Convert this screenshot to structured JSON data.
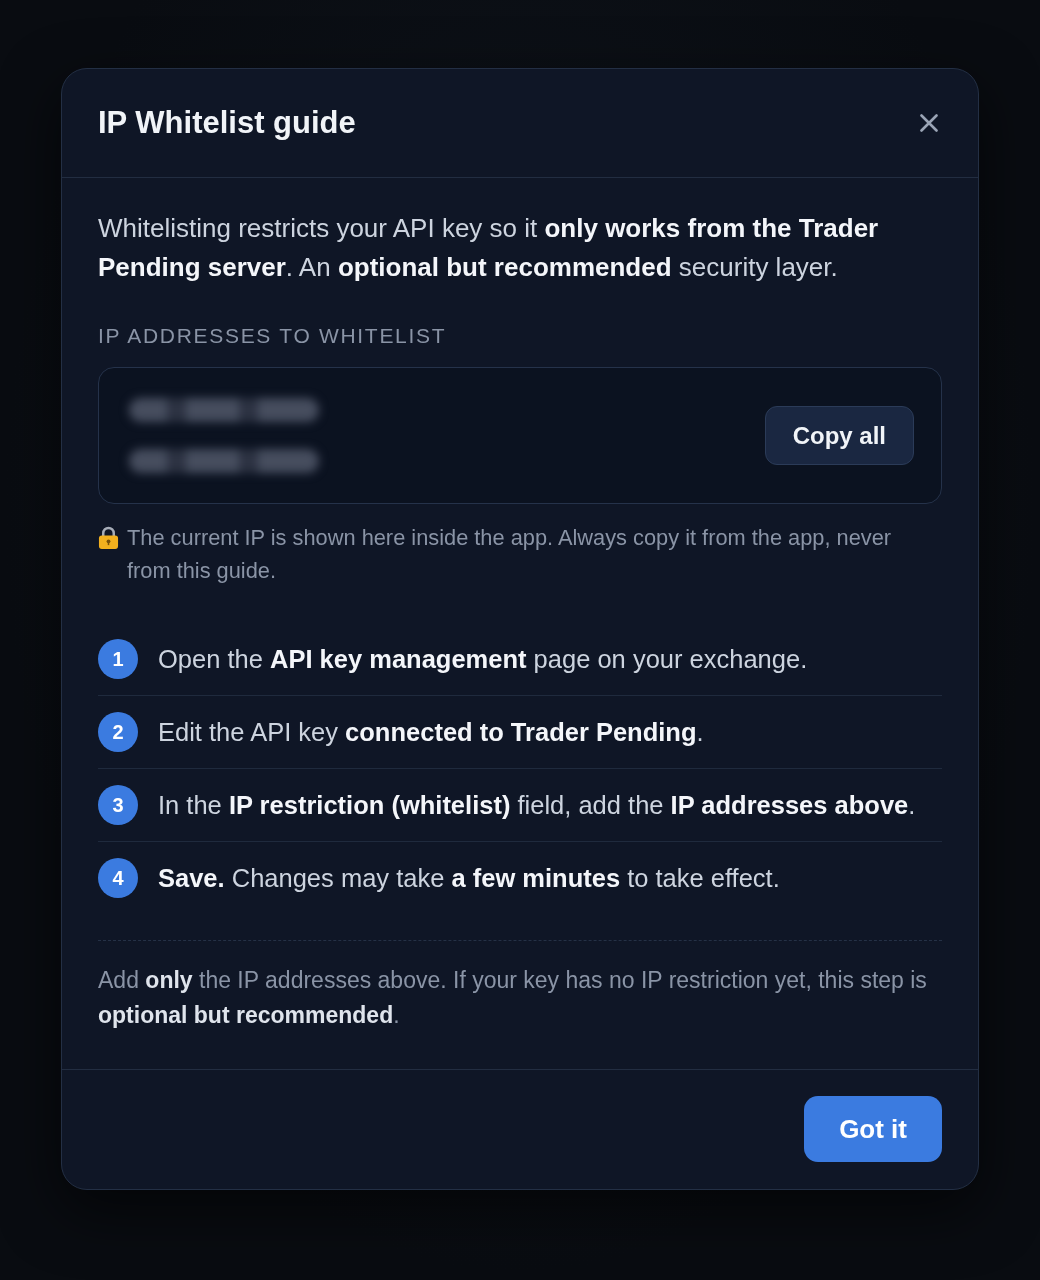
{
  "dialog": {
    "title": "IP Whitelist guide"
  },
  "intro": "Whitelisting restricts your API key so it **only works from the Trader Pending server**. An **optional but recommended** security layer.",
  "ip_section": {
    "label": "IP ADDRESSES TO WHITELIST",
    "addresses": [
      {
        "kind": "blurred"
      },
      {
        "kind": "blurred"
      }
    ],
    "copy_button": "Copy all",
    "note": "The current IP is shown here inside the app. Always copy it from the app, never from this guide."
  },
  "steps": [
    {
      "number": "1",
      "text": "Open the **API key management** page on your exchange."
    },
    {
      "number": "2",
      "text": "Edit the API key **connected to Trader Pending**."
    },
    {
      "number": "3",
      "text": "In the **IP restriction (whitelist)** field, add the **IP addresses above**."
    },
    {
      "number": "4",
      "text": "**Save.** Changes may take **a few minutes** to take effect."
    }
  ],
  "footnote": "Add **only** the IP addresses above. If your key has no IP restriction yet, this step is **optional but recommended**.",
  "footer": {
    "button": "Got it"
  }
}
